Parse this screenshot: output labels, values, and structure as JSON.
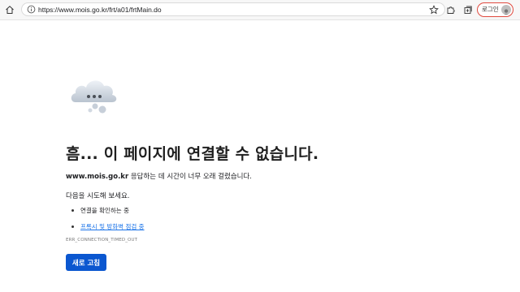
{
  "browser": {
    "url": "https://www.mois.go.kr/frt/a01/frtMain.do",
    "login_label": "로그인",
    "icons": [
      "home-icon",
      "info-icon",
      "star-icon",
      "extensions-icon",
      "collections-icon",
      "avatar-icon"
    ]
  },
  "error_page": {
    "icon": "cloud-icon",
    "title": "흠... 이 페이지에 연결할 수 없습니다.",
    "domain": "www.mois.go.kr",
    "desc_suffix": " 응답하는 데 시간이 너무 오래 걸렸습니다.",
    "try_label": "다음을 시도해 보세요.",
    "suggestions": [
      {
        "text": "연결을 확인하는 중",
        "is_link": false
      },
      {
        "text": "프록시 및 방화벽 점검 중",
        "is_link": true
      }
    ],
    "error_code": "ERR_CONNECTION_TIMED_OUT",
    "reload_label": "새로 고침"
  },
  "colors": {
    "accent": "#0b57d0",
    "login_border": "#e04a3f",
    "link": "#1a73e8"
  }
}
